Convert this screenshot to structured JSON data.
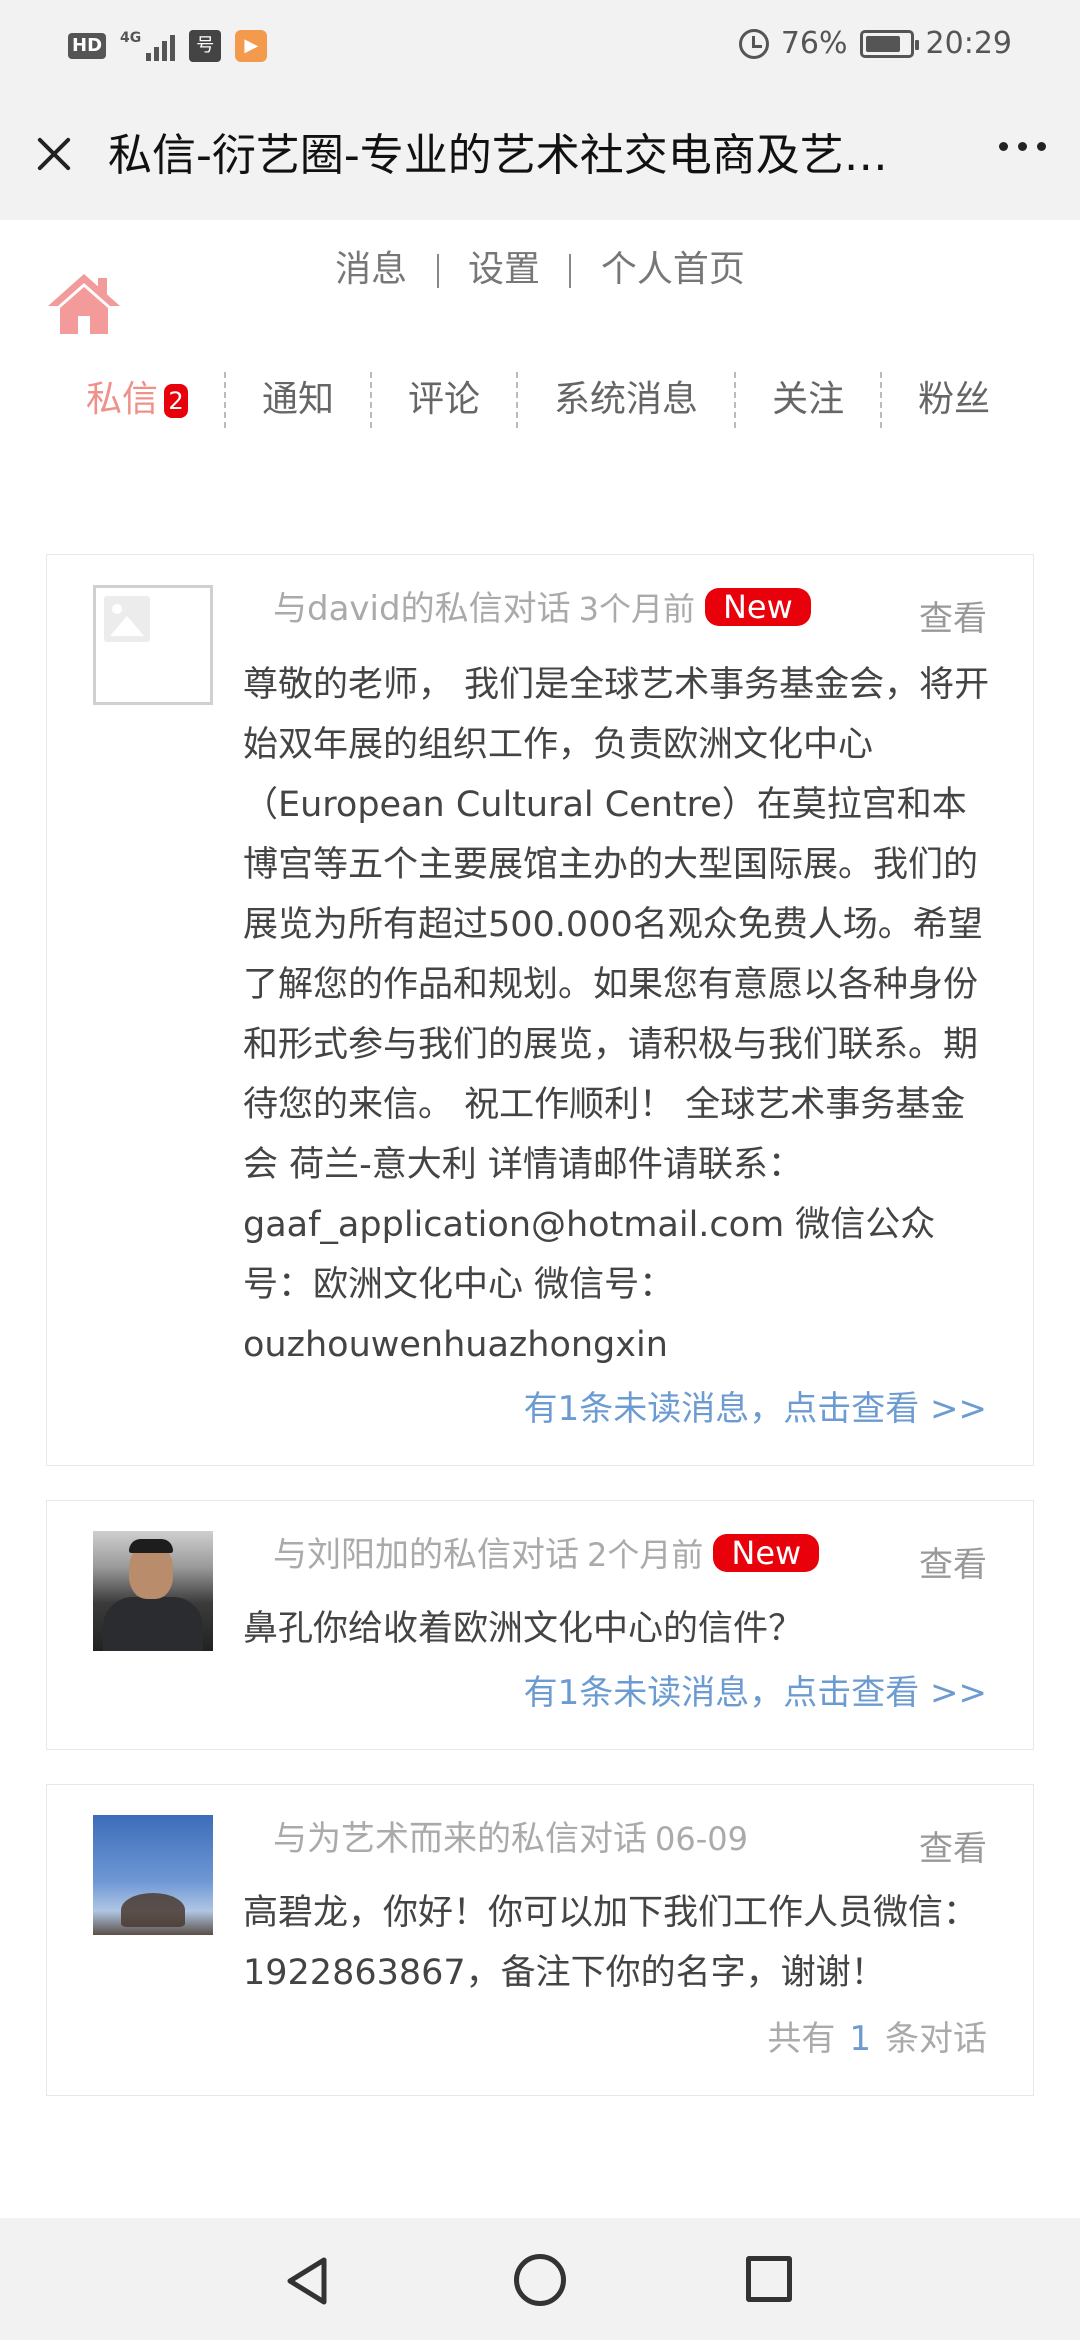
{
  "status_bar": {
    "hd": "HD",
    "network": "4G",
    "battery": "76%",
    "time": "20:29"
  },
  "title_bar": {
    "title": "私信-衍艺圈-专业的艺术社交电商及艺…"
  },
  "top_links": {
    "messages": "消息",
    "settings": "设置",
    "homepage": "个人首页"
  },
  "tabs": [
    {
      "label": "私信",
      "badge": "2"
    },
    {
      "label": "通知"
    },
    {
      "label": "评论"
    },
    {
      "label": "系统消息"
    },
    {
      "label": "关注"
    },
    {
      "label": "粉丝"
    }
  ],
  "messages": [
    {
      "header": "与david的私信对话",
      "time": "3个月前",
      "new_badge": "New",
      "view_label": "查看",
      "body": "尊敬的老师， 我们是全球艺术事务基金会，将开始双年展的组织工作，负责欧洲文化中心（European Cultural Centre）在莫拉宫和本博宫等五个主要展馆主办的大型国际展。我们的展览为所有超过500.000名观众免费人场。希望了解您的作品和规划。如果您有意愿以各种身份和形式参与我们的展览，请积极与我们联系。期待您的来信。 祝工作顺利！ 全球艺术事务基金会 荷兰-意大利 详情请邮件请联系：gaaf_application@hotmail.com 微信公众号：欧洲文化中心 微信号：ouzhouwenhuazhongxin",
      "unread_link": "有1条未读消息，点击查看 >>"
    },
    {
      "header": "与刘阳加的私信对话",
      "time": "2个月前",
      "new_badge": "New",
      "view_label": "查看",
      "body": "鼻孔你给收着欧洲文化中心的信件？",
      "unread_link": "有1条未读消息，点击查看 >>"
    },
    {
      "header": "与为艺术而来的私信对话",
      "time": "06-09",
      "view_label": "查看",
      "body": "高碧龙，你好！你可以加下我们工作人员微信：1922863867，备注下你的名字，谢谢！",
      "count_prefix": "共有",
      "count": "1",
      "count_suffix": "条对话"
    }
  ]
}
